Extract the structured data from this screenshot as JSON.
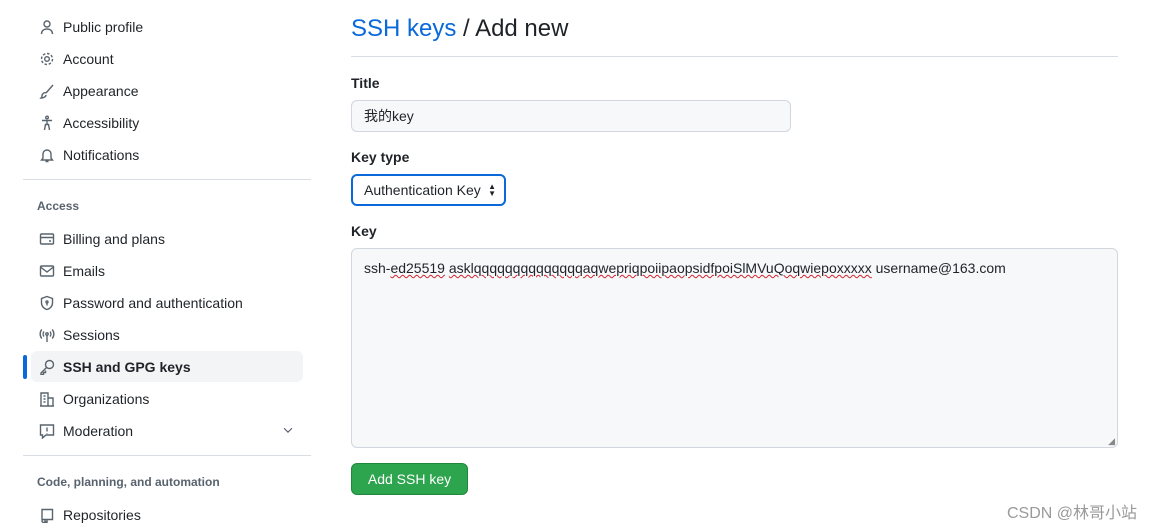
{
  "sidebar": {
    "group1": [
      {
        "label": "Public profile",
        "icon": "person-icon"
      },
      {
        "label": "Account",
        "icon": "gear-icon"
      },
      {
        "label": "Appearance",
        "icon": "paintbrush-icon"
      },
      {
        "label": "Accessibility",
        "icon": "accessibility-icon"
      },
      {
        "label": "Notifications",
        "icon": "bell-icon"
      }
    ],
    "access_heading": "Access",
    "group2": [
      {
        "label": "Billing and plans",
        "icon": "credit-card-icon"
      },
      {
        "label": "Emails",
        "icon": "mail-icon"
      },
      {
        "label": "Password and authentication",
        "icon": "shield-icon"
      },
      {
        "label": "Sessions",
        "icon": "broadcast-icon"
      },
      {
        "label": "SSH and GPG keys",
        "icon": "key-icon",
        "active": true
      },
      {
        "label": "Organizations",
        "icon": "organization-icon"
      },
      {
        "label": "Moderation",
        "icon": "report-icon"
      }
    ],
    "code_heading": "Code, planning, and automation",
    "group3": [
      {
        "label": "Repositories",
        "icon": "repo-icon"
      }
    ]
  },
  "main": {
    "breadcrumb_link": "SSH keys",
    "breadcrumb_sep": " / ",
    "title": "Add new",
    "title_label": "Title",
    "title_value": "我的key",
    "key_type_label": "Key type",
    "key_type_value": "Authentication Key",
    "key_label": "Key",
    "key_parts": [
      "ssh-",
      "ed25519",
      " ",
      "asklqqqqqqqqqqqqqqaqwepriqpoiipaopsidfpoiSlMVuQoqwiepoxxxxx",
      " username@163.com"
    ],
    "submit_label": "Add SSH key"
  },
  "watermark": "CSDN @林哥小站",
  "colors": {
    "accent": "#0969da",
    "button": "#2da44e"
  }
}
